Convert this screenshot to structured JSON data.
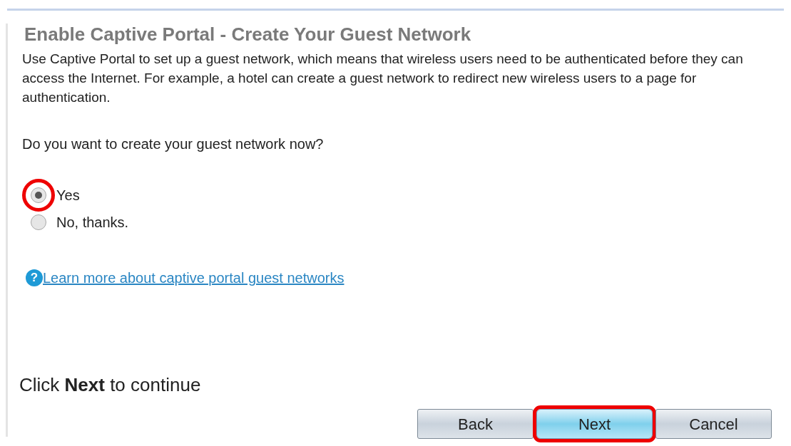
{
  "title": "Enable Captive Portal - Create Your Guest Network",
  "description": "Use Captive Portal to set up a guest network, which means that wireless users need to be authenticated before they can access the Internet. For example, a hotel can create a guest network to redirect new wireless users to a page for authentication.",
  "question": "Do you want to create your guest network now?",
  "options": [
    {
      "label": "Yes",
      "selected": true,
      "highlighted": true
    },
    {
      "label": "No, thanks.",
      "selected": false,
      "highlighted": false
    }
  ],
  "help_icon": "?",
  "help_link": "Learn more about captive portal guest networks",
  "instruction": "Click **Next** to continue",
  "buttons": [
    {
      "label": "Back",
      "kind": "secondary",
      "highlighted": false
    },
    {
      "label": "Next",
      "kind": "primary",
      "highlighted": true
    },
    {
      "label": "Cancel",
      "kind": "secondary",
      "highlighted": false
    }
  ]
}
